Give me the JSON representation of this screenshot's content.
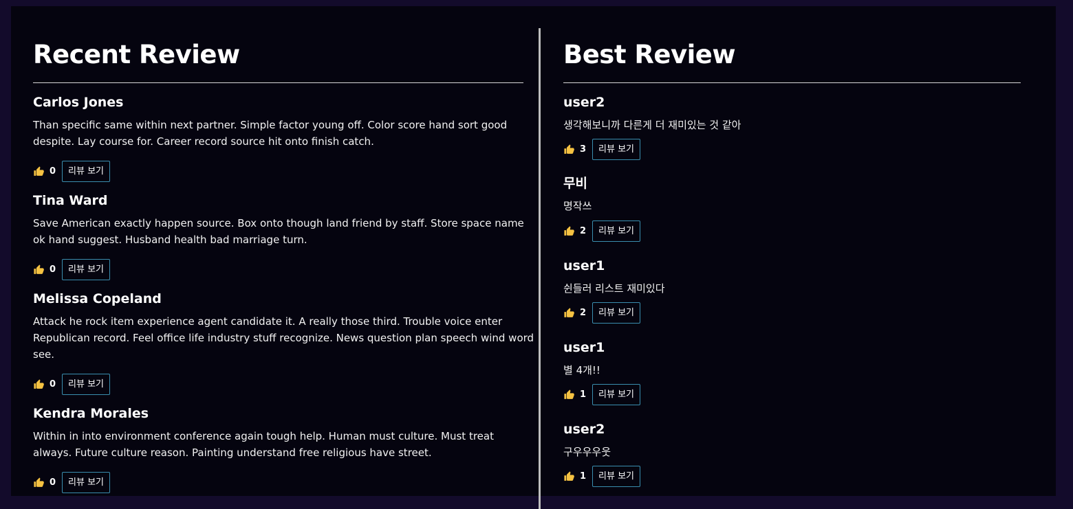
{
  "recent": {
    "title": "Recent Review",
    "reviews": [
      {
        "author": "Carlos Jones",
        "text": "Than specific same within next partner. Simple factor young off. Color score hand sort good despite. Lay course for. Career record source hit onto finish catch.",
        "likes": "0",
        "button": "리뷰 보기"
      },
      {
        "author": "Tina Ward",
        "text": "Save American exactly happen source. Box onto though land friend by staff. Store space name ok hand suggest. Husband health bad marriage turn.",
        "likes": "0",
        "button": "리뷰 보기"
      },
      {
        "author": "Melissa Copeland",
        "text": "Attack he rock item experience agent candidate it. A really those third. Trouble voice enter Republican record. Feel office life industry stuff recognize. News question plan speech wind word see.",
        "likes": "0",
        "button": "리뷰 보기"
      },
      {
        "author": "Kendra Morales",
        "text": "Within in into environment conference again tough help. Human must culture. Must treat always. Future culture reason. Painting understand free religious have street.",
        "likes": "0",
        "button": "리뷰 보기"
      }
    ]
  },
  "best": {
    "title": "Best Review",
    "reviews": [
      {
        "author": "user2",
        "text": "생각해보니까 다른게 더 재미있는 것 같아",
        "likes": "3",
        "button": "리뷰 보기"
      },
      {
        "author": "무비",
        "text": "명작쓰",
        "likes": "2",
        "button": "리뷰 보기"
      },
      {
        "author": "user1",
        "text": "쉰들러 리스트 재미있다",
        "likes": "2",
        "button": "리뷰 보기"
      },
      {
        "author": "user1",
        "text": "별 4개!!",
        "likes": "1",
        "button": "리뷰 보기"
      },
      {
        "author": "user2",
        "text": "구우우우웃",
        "likes": "1",
        "button": "리뷰 보기"
      }
    ]
  },
  "icons": {
    "like": "thumbs-up-icon"
  },
  "colors": {
    "page_bg": "#130b2b",
    "panel_bg": "#05040f",
    "button_border": "#3a8fb0",
    "thumb": "#f5c242"
  }
}
